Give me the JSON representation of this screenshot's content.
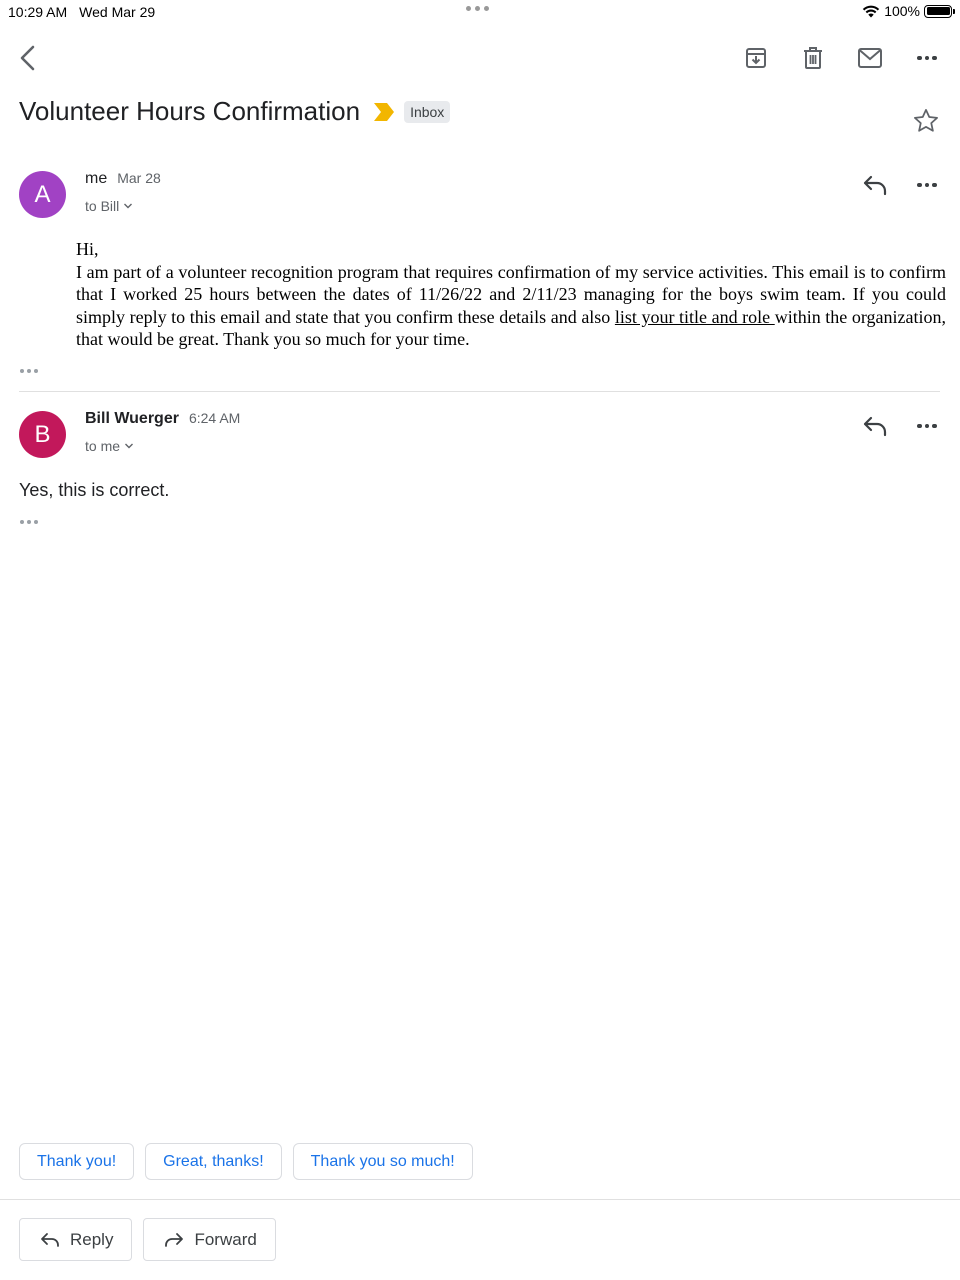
{
  "status_bar": {
    "time": "10:29 AM",
    "date": "Wed Mar 29",
    "battery": "100%"
  },
  "toolbar": {
    "icons": [
      "back-icon",
      "archive-icon",
      "trash-icon",
      "mail-icon",
      "more-icon"
    ]
  },
  "email": {
    "subject": "Volunteer Hours Confirmation",
    "label": "Inbox",
    "important_color": "#f2b600"
  },
  "messages": [
    {
      "avatar_letter": "A",
      "avatar_color": "#a142c4",
      "sender": "me",
      "time": "Mar 28",
      "recipient": "to Bill",
      "greeting": "Hi,",
      "body_text": "I am part of a volunteer recognition program that requires confirmation of my service activities. This email is to confirm that I worked 25 hours between the dates of 11/26/22 and 2/11/23 managing for the boys swim team. If you could simply reply to this email and state that you confirm these details and also ",
      "body_underlined": "list your title and role ",
      "body_end": "within the organization, that would be great. Thank you so much for your time."
    },
    {
      "avatar_letter": "B",
      "avatar_color": "#c2185b",
      "sender": "Bill Wuerger",
      "time": "6:24 AM",
      "recipient": "to me",
      "body": "Yes, this is correct."
    }
  ],
  "smart_replies": [
    "Thank you!",
    "Great, thanks!",
    "Thank you so much!"
  ],
  "actions": {
    "reply": "Reply",
    "forward": "Forward"
  }
}
